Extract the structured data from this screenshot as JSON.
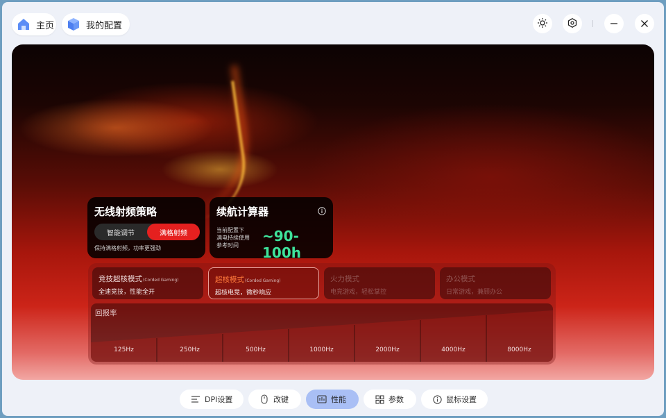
{
  "top": {
    "home_label": "主页",
    "config_label": "我的配置"
  },
  "wireless_card": {
    "title": "无线射频策略",
    "options": [
      "智能调节",
      "满格射频"
    ],
    "selected": "满格射频",
    "note": "保持满格射频，功率更强劲"
  },
  "battery_card": {
    "title": "续航计算器",
    "lines": [
      "当前配置下",
      "满电持续使用",
      "参考时间"
    ],
    "value": "~90-100h"
  },
  "modes": [
    {
      "title": "竞技超核模式",
      "tag": "(Corded Gaming)",
      "desc": "全速竞技，性能全开",
      "state": "normal"
    },
    {
      "title": "超核模式",
      "tag": "(Corded Gaming)",
      "desc": "超核电竞，微秒响应",
      "state": "selected"
    },
    {
      "title": "火力模式",
      "tag": "",
      "desc": "电竞游戏，轻松掌控",
      "state": "dim"
    },
    {
      "title": "办公模式",
      "tag": "",
      "desc": "日常游戏，兼顾办公",
      "state": "dim"
    }
  ],
  "polling": {
    "title": "回报率",
    "options": [
      "125Hz",
      "250Hz",
      "500Hz",
      "1000Hz",
      "2000Hz",
      "4000Hz",
      "8000Hz"
    ]
  },
  "nav": [
    {
      "label": "DPI设置",
      "icon": "dpi-icon"
    },
    {
      "label": "改键",
      "icon": "mouse-icon"
    },
    {
      "label": "性能",
      "icon": "performance-icon",
      "active": true
    },
    {
      "label": "参数",
      "icon": "grid-icon"
    },
    {
      "label": "鼠标设置",
      "icon": "info-icon"
    }
  ],
  "colors": {
    "accent_red": "#e5201f",
    "battery_green": "#3ee39b",
    "nav_active": "#a9bff5"
  }
}
